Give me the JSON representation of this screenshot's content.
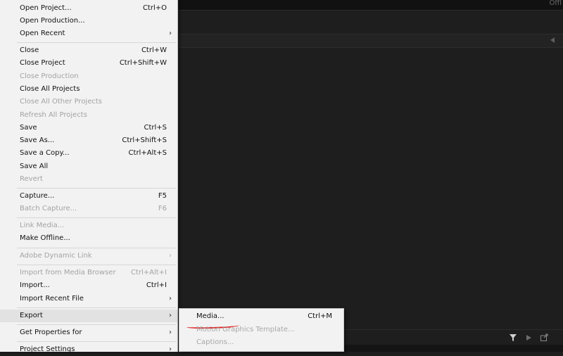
{
  "app": {
    "top_tab": "Offl"
  },
  "toolbar_icons": [
    "filter-icon",
    "play-icon",
    "export-icon"
  ],
  "file_menu": {
    "items": [
      {
        "label": "Open Project...",
        "shortcut": "Ctrl+O",
        "disabled": false,
        "submenu": false
      },
      {
        "label": "Open Production...",
        "shortcut": "",
        "disabled": false,
        "submenu": false
      },
      {
        "label": "Open Recent",
        "shortcut": "",
        "disabled": false,
        "submenu": true
      },
      {
        "label": "Close",
        "shortcut": "Ctrl+W",
        "disabled": false,
        "submenu": false
      },
      {
        "label": "Close Project",
        "shortcut": "Ctrl+Shift+W",
        "disabled": false,
        "submenu": false
      },
      {
        "label": "Close Production",
        "shortcut": "",
        "disabled": true,
        "submenu": false
      },
      {
        "label": "Close All Projects",
        "shortcut": "",
        "disabled": false,
        "submenu": false
      },
      {
        "label": "Close All Other Projects",
        "shortcut": "",
        "disabled": true,
        "submenu": false
      },
      {
        "label": "Refresh All Projects",
        "shortcut": "",
        "disabled": true,
        "submenu": false
      },
      {
        "label": "Save",
        "shortcut": "Ctrl+S",
        "disabled": false,
        "submenu": false
      },
      {
        "label": "Save As...",
        "shortcut": "Ctrl+Shift+S",
        "disabled": false,
        "submenu": false
      },
      {
        "label": "Save a Copy...",
        "shortcut": "Ctrl+Alt+S",
        "disabled": false,
        "submenu": false
      },
      {
        "label": "Save All",
        "shortcut": "",
        "disabled": false,
        "submenu": false
      },
      {
        "label": "Revert",
        "shortcut": "",
        "disabled": true,
        "submenu": false
      },
      {
        "label": "Capture...",
        "shortcut": "F5",
        "disabled": false,
        "submenu": false
      },
      {
        "label": "Batch Capture...",
        "shortcut": "F6",
        "disabled": true,
        "submenu": false
      },
      {
        "label": "Link Media...",
        "shortcut": "",
        "disabled": true,
        "submenu": false
      },
      {
        "label": "Make Offline...",
        "shortcut": "",
        "disabled": false,
        "submenu": false
      },
      {
        "label": "Adobe Dynamic Link",
        "shortcut": "",
        "disabled": true,
        "submenu": true
      },
      {
        "label": "Import from Media Browser",
        "shortcut": "Ctrl+Alt+I",
        "disabled": true,
        "submenu": false
      },
      {
        "label": "Import...",
        "shortcut": "Ctrl+I",
        "disabled": false,
        "submenu": false
      },
      {
        "label": "Import Recent File",
        "shortcut": "",
        "disabled": false,
        "submenu": true
      },
      {
        "label": "Export",
        "shortcut": "",
        "disabled": false,
        "submenu": true
      },
      {
        "label": "Get Properties for",
        "shortcut": "",
        "disabled": false,
        "submenu": true
      },
      {
        "label": "Project Settings",
        "shortcut": "",
        "disabled": false,
        "submenu": true
      }
    ]
  },
  "export_submenu": {
    "items": [
      {
        "label": "Media...",
        "shortcut": "Ctrl+M",
        "disabled": false
      },
      {
        "label": "Motion Graphics Template...",
        "shortcut": "",
        "disabled": true
      },
      {
        "label": "Captions...",
        "shortcut": "",
        "disabled": true
      }
    ],
    "annotation_color": "#e02020"
  }
}
